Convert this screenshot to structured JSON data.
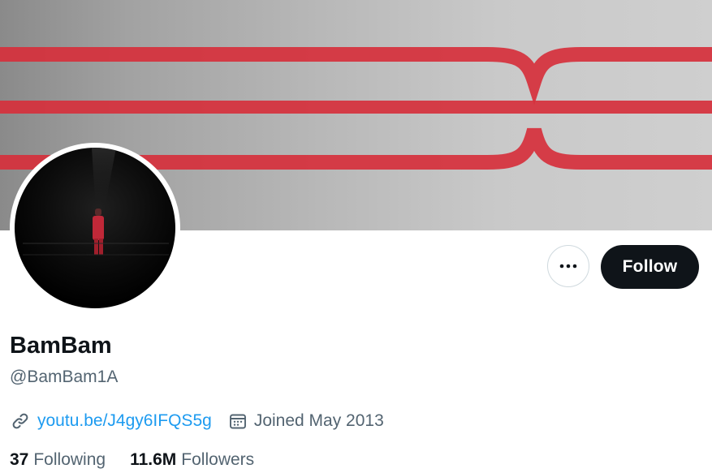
{
  "profile": {
    "name": "BamBam",
    "handle": "@BamBam1A",
    "website": "youtu.be/J4gy6IFQS5g",
    "joined": "Joined May 2013"
  },
  "actions": {
    "more_icon": "more-horizontal-icon",
    "follow_label": "Follow"
  },
  "stats": {
    "following_count": "37",
    "following_label": "Following",
    "followers_count": "11.6M",
    "followers_label": "Followers"
  },
  "icons": {
    "link": "link-icon",
    "calendar": "calendar-icon"
  },
  "colors": {
    "accent_link": "#1d9bf0",
    "text_primary": "#0f1419",
    "text_secondary": "#536471",
    "button_dark": "#0f1419",
    "banner_stripe": "#d6303c"
  }
}
